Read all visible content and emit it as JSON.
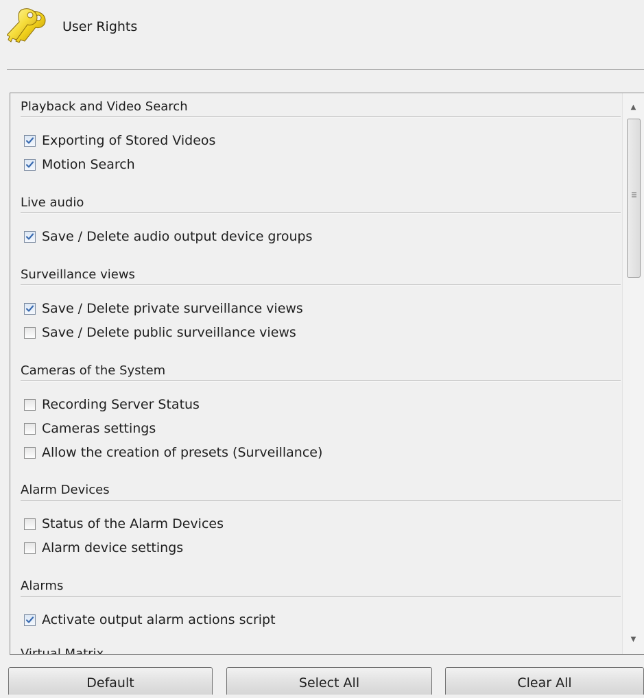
{
  "header": {
    "title": "User Rights",
    "icon": "keys-icon"
  },
  "sections": [
    {
      "title": "Playback and Video Search",
      "items": [
        {
          "label": "Exporting of Stored Videos",
          "checked": true
        },
        {
          "label": "Motion Search",
          "checked": true
        }
      ]
    },
    {
      "title": "Live audio",
      "items": [
        {
          "label": "Save / Delete audio output device groups",
          "checked": true
        }
      ]
    },
    {
      "title": "Surveillance views",
      "items": [
        {
          "label": "Save / Delete private surveillance views",
          "checked": true
        },
        {
          "label": "Save / Delete public surveillance views",
          "checked": false
        }
      ]
    },
    {
      "title": "Cameras of the System",
      "items": [
        {
          "label": "Recording Server Status",
          "checked": false
        },
        {
          "label": "Cameras settings",
          "checked": false
        },
        {
          "label": "Allow the creation of presets (Surveillance)",
          "checked": false
        }
      ]
    },
    {
      "title": "Alarm Devices",
      "items": [
        {
          "label": "Status of the Alarm Devices",
          "checked": false
        },
        {
          "label": "Alarm device settings",
          "checked": false
        }
      ]
    },
    {
      "title": "Alarms",
      "items": [
        {
          "label": "Activate output alarm actions script",
          "checked": true
        }
      ]
    },
    {
      "title": "Virtual Matrix",
      "items": []
    }
  ],
  "buttons": {
    "default_label": "Default",
    "select_all_label": "Select All",
    "clear_all_label": "Clear All"
  },
  "colors": {
    "background": "#f0f0f0",
    "checkmark": "#3a6bb0"
  }
}
